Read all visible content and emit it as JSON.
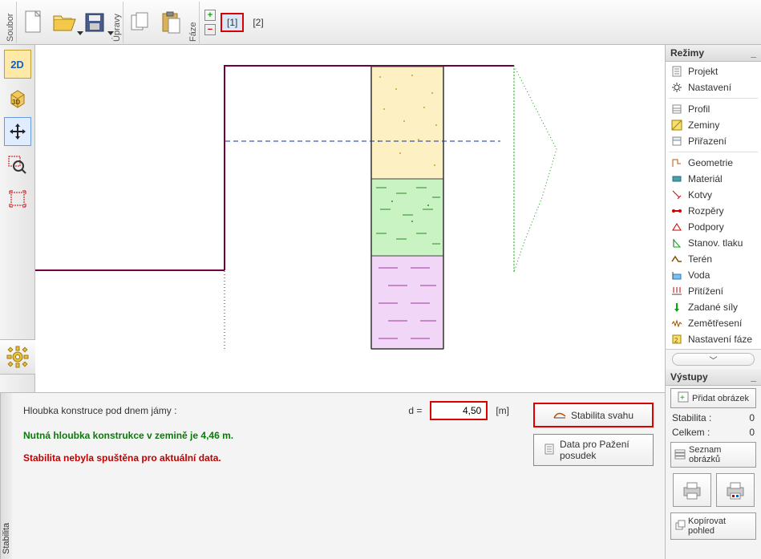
{
  "toolbar": {
    "soubor_label": "Soubor",
    "upravy_label": "Úpravy",
    "faze_label": "Fáze",
    "phase1": "[1]",
    "phase2": "[2]"
  },
  "modes_header": "Režimy",
  "modes": {
    "group1": [
      "Projekt",
      "Nastavení"
    ],
    "group2": [
      "Profil",
      "Zeminy",
      "Přiřazení"
    ],
    "group3": [
      "Geometrie",
      "Materiál",
      "Kotvy",
      "Rozpěry",
      "Podpory",
      "Stanov. tlaku",
      "Terén",
      "Voda",
      "Přitížení",
      "Zadané síly",
      "Zemětřesení",
      "Nastavení fáze"
    ]
  },
  "outputs": {
    "header": "Výstupy",
    "add_img": "Přidat obrázek",
    "stabilita_label": "Stabilita :",
    "stabilita_val": "0",
    "celkem_label": "Celkem :",
    "celkem_val": "0",
    "list_img": "Seznam obrázků",
    "copy_view": "Kopírovat pohled"
  },
  "bottom": {
    "tab": "Stabilita",
    "depth_label": "Hloubka konstruce pod dnem jámy :",
    "d_sym": "d =",
    "depth_value": "4,50",
    "depth_unit": "[m]",
    "need": "Nutná hloubka konstrukce v zemině je 4,46 m.",
    "warn": "Stabilita nebyla spuštěna pro aktuální data.",
    "btn_stab": "Stabilita svahu",
    "btn_data": "Data pro Pažení posudek"
  },
  "chart_data": {
    "type": "diagram",
    "description": "Cross-section of a sheeting wall. Ground surface left of wall, excavation on right. Wall with three soil layers (yellow dotted, green dashed pattern, pink dashed). Dashed blue water line. Green dotted earth-pressure envelope on right side.",
    "depth_below_pit": 4.5,
    "required_depth": 4.46,
    "layers": [
      {
        "color": "#fdf0c3",
        "pattern": "dots",
        "approx_thickness_rel": 0.32
      },
      {
        "color": "#c9f3c3",
        "pattern": "short-dashes",
        "approx_thickness_rel": 0.22
      },
      {
        "color": "#f2d6f7",
        "pattern": "long-dashes",
        "approx_thickness_rel": 0.46
      }
    ]
  }
}
